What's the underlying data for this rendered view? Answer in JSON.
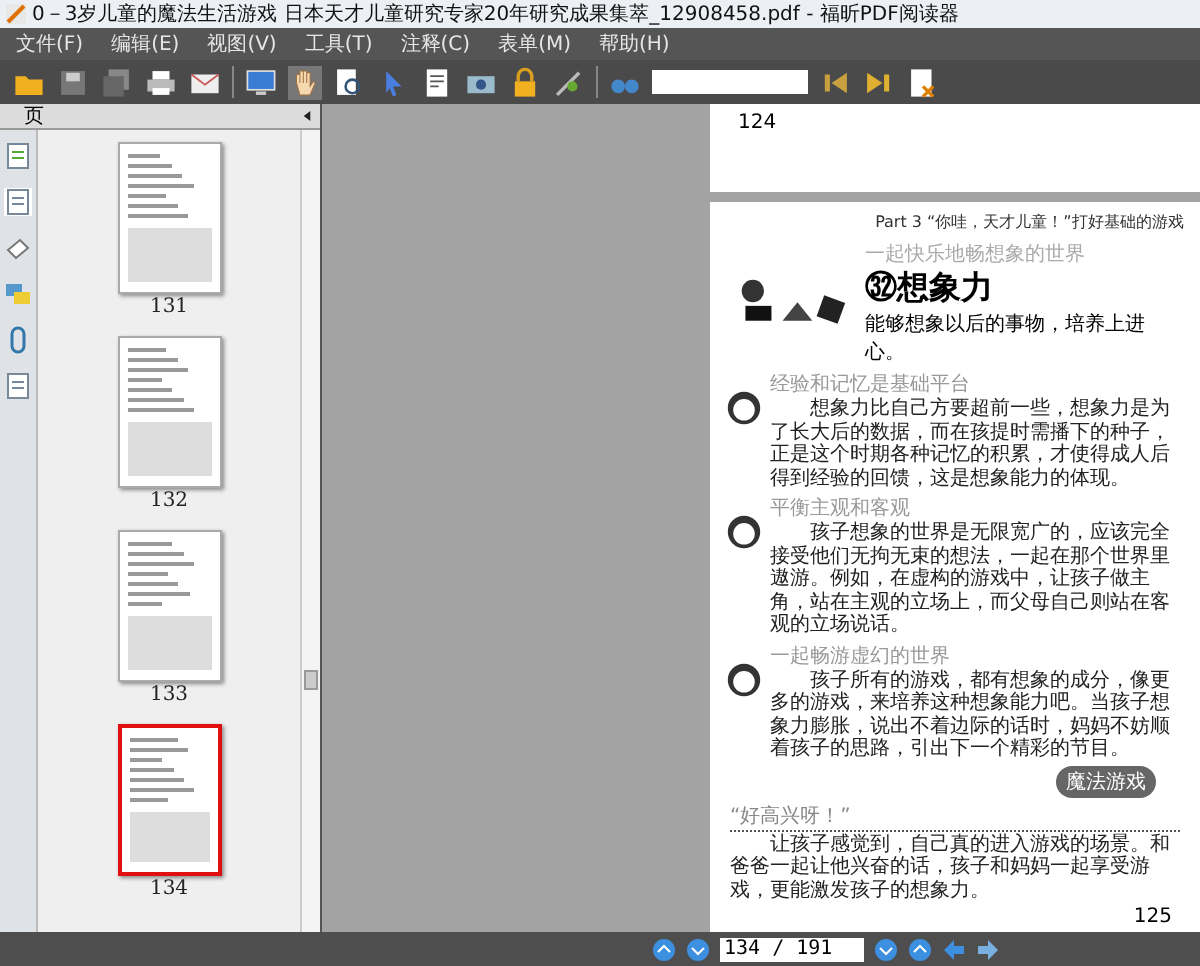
{
  "window": {
    "title": "0－3岁儿童的魔法生活游戏  日本天才儿童研究专家20年研究成果集萃_12908458.pdf - 福昕PDF阅读器"
  },
  "menu": [
    {
      "label": "文件(F)"
    },
    {
      "label": "编辑(E)"
    },
    {
      "label": "视图(V)"
    },
    {
      "label": "工具(T)"
    },
    {
      "label": "注释(C)"
    },
    {
      "label": "表单(M)"
    },
    {
      "label": "帮助(H)"
    }
  ],
  "sidebar": {
    "header": "页",
    "thumbnails": [
      {
        "label": "131",
        "selected": false
      },
      {
        "label": "132",
        "selected": false
      },
      {
        "label": "133",
        "selected": false
      },
      {
        "label": "134",
        "selected": true
      }
    ]
  },
  "document": {
    "previous_page_number": "124",
    "page": {
      "part_header": "Part 3  “你哇，天才儿童！”打好基础的游戏",
      "tagline": "一起快乐地畅想象的世界",
      "title": "㉜想象力",
      "subtitle": "能够想象以后的事物，培养上进心。",
      "sections": [
        {
          "heading": "经验和记忆是基础平台",
          "body": "想象力比自己方要超前一些，想象力是为了长大后的数据，而在孩提时需播下的种子，正是这个时期各种记忆的积累，才使得成人后得到经验的回馈，这是想象能力的体现。"
        },
        {
          "heading": "平衡主观和客观",
          "body": "孩子想象的世界是无限宽广的，应该完全接受他们无拘无束的想法，一起在那个世界里遨游。例如，在虚构的游戏中，让孩子做主角，站在主观的立场上，而父母自己则站在客观的立场说话。"
        },
        {
          "heading": "一起畅游虚幻的世界",
          "body": "孩子所有的游戏，都有想象的成分，像更多的游戏，来培养这种想象能力吧。当孩子想象力膨胀，说出不着边际的话时，妈妈不妨顺着孩子的思路，引出下一个精彩的节目。"
        }
      ],
      "badge": "魔法游戏",
      "quote": {
        "heading": "“好高兴呀！”",
        "body": "让孩子感觉到，自己真的进入游戏的场景。和爸爸一起让他兴奋的话，孩子和妈妈一起享受游戏，更能激发孩子的想象力。"
      },
      "page_number": "125"
    }
  },
  "status_bar": {
    "page_field": "134 / 191"
  }
}
